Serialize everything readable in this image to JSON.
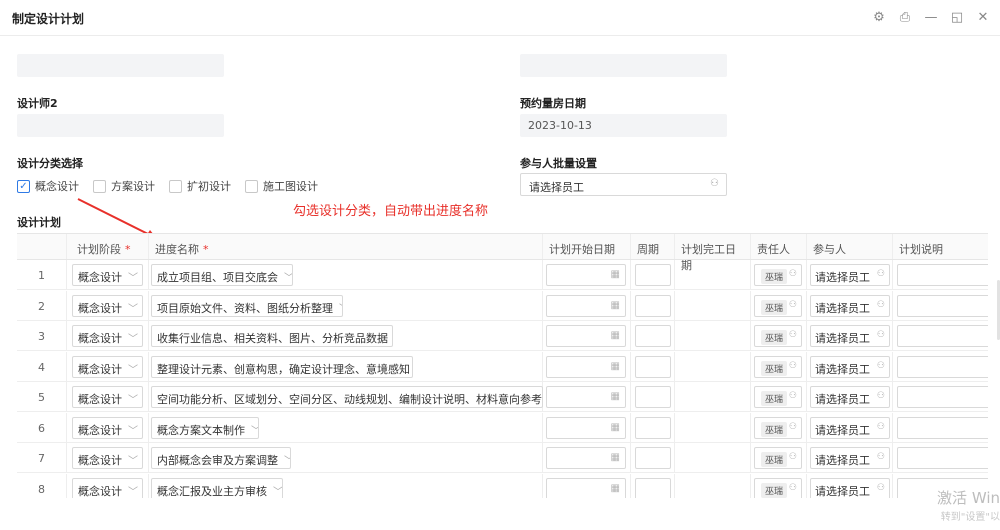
{
  "window": {
    "title": "制定设计计划",
    "icons": [
      "settings-icon",
      "print-icon",
      "minimize-icon",
      "maximize-icon",
      "close-icon"
    ]
  },
  "form": {
    "designer2_label": "设计师2",
    "reserve_date_label": "预约量房日期",
    "reserve_date_value": "2023-10-13",
    "category_label": "设计分类选择",
    "categories": [
      {
        "label": "概念设计",
        "checked": true
      },
      {
        "label": "方案设计",
        "checked": false
      },
      {
        "label": "扩初设计",
        "checked": false
      },
      {
        "label": "施工图设计",
        "checked": false
      }
    ],
    "participants_label": "参与人批量设置",
    "participants_placeholder": "请选择员工",
    "plan_label": "设计计划"
  },
  "annotation": "勾选设计分类，自动带出进度名称",
  "table": {
    "headers": {
      "stage": "计划阶段",
      "progress": "进度名称",
      "start": "计划开始日期",
      "period": "周期",
      "end": "计划完工日期",
      "owner": "责任人",
      "participants": "参与人",
      "note": "计划说明"
    },
    "rows": [
      {
        "idx": "1",
        "stage": "概念设计",
        "progress": "成立项目组、项目交底会",
        "owner": "巫瑞",
        "participants": "请选择员工"
      },
      {
        "idx": "2",
        "stage": "概念设计",
        "progress": "项目原始文件、资料、图纸分析整理",
        "owner": "巫瑞",
        "participants": "请选择员工"
      },
      {
        "idx": "3",
        "stage": "概念设计",
        "progress": "收集行业信息、相关资料、图片、分析竞品数据",
        "owner": "巫瑞",
        "participants": "请选择员工"
      },
      {
        "idx": "4",
        "stage": "概念设计",
        "progress": "整理设计元素、创意构思，确定设计理念、意境感知",
        "owner": "巫瑞",
        "participants": "请选择员工"
      },
      {
        "idx": "5",
        "stage": "概念设计",
        "progress": "空间功能分析、区域划分、空间分区、动线规划、编制设计说明、材料意向参考",
        "owner": "巫瑞",
        "participants": "请选择员工"
      },
      {
        "idx": "6",
        "stage": "概念设计",
        "progress": "概念方案文本制作",
        "owner": "巫瑞",
        "participants": "请选择员工"
      },
      {
        "idx": "7",
        "stage": "概念设计",
        "progress": "内部概念会审及方案调整",
        "owner": "巫瑞",
        "participants": "请选择员工"
      },
      {
        "idx": "8",
        "stage": "概念设计",
        "progress": "概念汇报及业主方审核",
        "owner": "巫瑞",
        "participants": "请选择员工"
      }
    ]
  },
  "watermark": {
    "line1": "激活 Win",
    "line2": "转到\"设置\"以"
  },
  "colors": {
    "accent": "#2f7ae5",
    "required": "#e8302a",
    "annotation": "#e8302a"
  }
}
